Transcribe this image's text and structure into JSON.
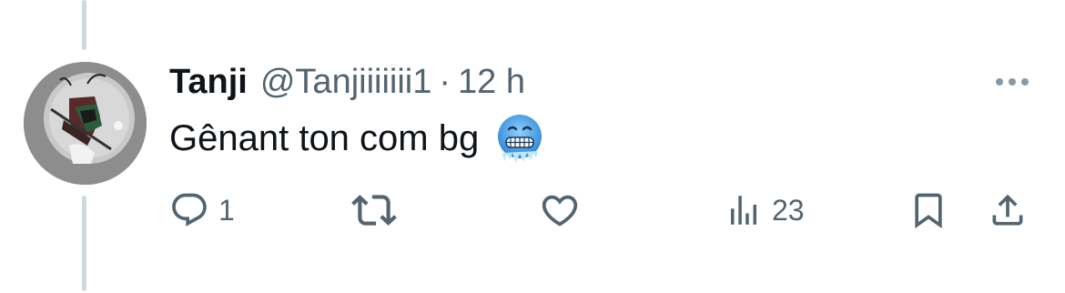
{
  "tweet": {
    "display_name": "Tanji",
    "handle": "@Tanjiiiiiii1",
    "separator": "·",
    "time": "12 h",
    "text": "Gênant ton com bg",
    "emoji": "cold-face-emoji"
  },
  "actions": {
    "reply_count": "1",
    "retweet_count": "",
    "like_count": "",
    "views_count": "23"
  },
  "icons": {
    "more": "more-horizontal-icon",
    "reply": "reply-icon",
    "retweet": "retweet-icon",
    "like": "heart-icon",
    "views": "views-chart-icon",
    "bookmark": "bookmark-icon",
    "share": "share-icon"
  },
  "colors": {
    "text_primary": "#0f1419",
    "text_secondary": "#536471",
    "thread_line": "#cfd9de",
    "emoji_blue": "#4a9fe0"
  }
}
